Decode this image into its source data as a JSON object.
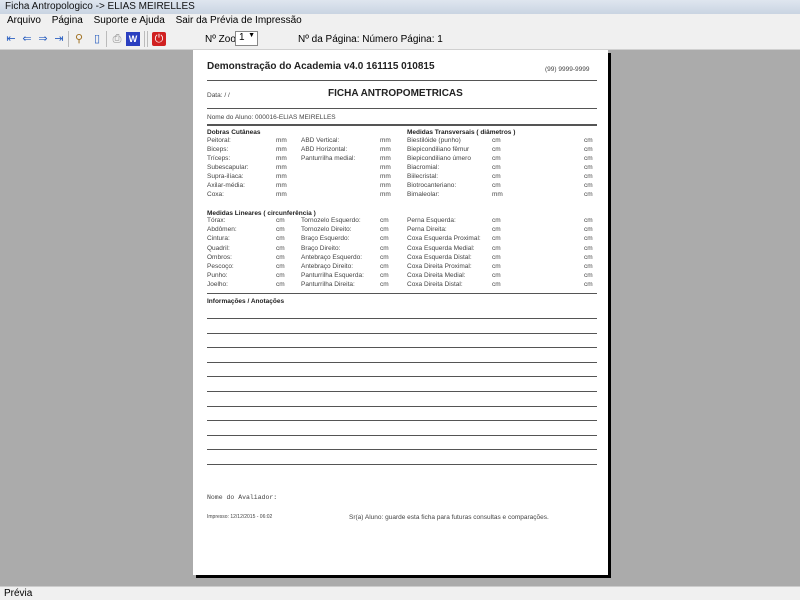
{
  "window": {
    "title": "Ficha Antropologico -> ELIAS MEIRELLES"
  },
  "menu": [
    "Arquivo",
    "Página",
    "Suporte e Ajuda",
    "Sair da Prévia de Impressão"
  ],
  "toolbar": {
    "zoom_label": "Nº Zoom",
    "zoom_value": "1",
    "page_label": "Nº da Página: Número Página: 1"
  },
  "report": {
    "company": "Demonstração do Academia v4.0 161115 010815",
    "phone": "(99) 9999-9999",
    "date": "Data:  /  /",
    "title": "FICHA ANTROPOMETRICAS",
    "student": "Nome do Aluno: 000016-ELIAS MEIRELLES",
    "dobras_title": "Dobras Cutâneas",
    "transversais_title": "Medidas Transversais ( diâmetros )",
    "lineares_title": "Medidas Lineares ( circunferência )",
    "notes_title": "Informações / Anotações",
    "evaluator": "Nome do Avaliador:",
    "printed": "Impresso: 12/12/2015 - 06:02",
    "footer": "Sr(a) Aluno: guarde esta ficha para futuras consultas e comparações.",
    "rows1": [
      [
        "Peitoral:",
        "mm",
        "ABD Vertical:",
        "mm",
        "Biestilóide (punho)",
        "cm",
        "cm"
      ],
      [
        "Biceps:",
        "mm",
        "ABD Horizontal:",
        "mm",
        "Biepicondiliano fêmur",
        "cm",
        "cm"
      ],
      [
        "Tríceps:",
        "mm",
        "Panturrilha medial:",
        "mm",
        "Biepicondiliano úmero",
        "cm",
        "cm"
      ],
      [
        "Subescapular:",
        "mm",
        "",
        "mm",
        "Biacromial:",
        "cm",
        "cm"
      ],
      [
        "Supra-ilíaca:",
        "mm",
        "",
        "mm",
        "Biilecristal:",
        "cm",
        "cm"
      ],
      [
        "Axilar-média:",
        "mm",
        "",
        "mm",
        "Biotrocanteriano:",
        "cm",
        "cm"
      ],
      [
        "Coxa:",
        "mm",
        "",
        "mm",
        "Bimaleolar:",
        "mm",
        "cm"
      ]
    ],
    "rows2": [
      [
        "Tórax:",
        "cm",
        "Tornozelo Esquerdo:",
        "cm",
        "Perna Esquerda:",
        "cm",
        "cm"
      ],
      [
        "Abdômen:",
        "cm",
        "Tornozelo Direito:",
        "cm",
        "Perna Direita:",
        "cm",
        "cm"
      ],
      [
        "Cintura:",
        "cm",
        "Braço Esquerdo:",
        "cm",
        "Coxa Esquerda Proximal:",
        "cm",
        "cm"
      ],
      [
        "Quadril:",
        "cm",
        "Braço Direito:",
        "cm",
        "Coxa Esquerda Medial:",
        "cm",
        "cm"
      ],
      [
        "Ombros:",
        "cm",
        "Antebraço Esquerdo:",
        "cm",
        "Coxa Esquerda Distal:",
        "cm",
        "cm"
      ],
      [
        "Pescoço:",
        "cm",
        "Antebraço Direito:",
        "cm",
        "Coxa Direita Proximal:",
        "cm",
        "cm"
      ],
      [
        "Punho:",
        "cm",
        "Panturrilha Esquerda:",
        "cm",
        "Coxa Direita Medial:",
        "cm",
        "cm"
      ],
      [
        "Joelho:",
        "cm",
        "Panturrilha Direita:",
        "cm",
        "Coxa Direita Distal:",
        "cm",
        "cm"
      ]
    ]
  },
  "status": "Prévia"
}
